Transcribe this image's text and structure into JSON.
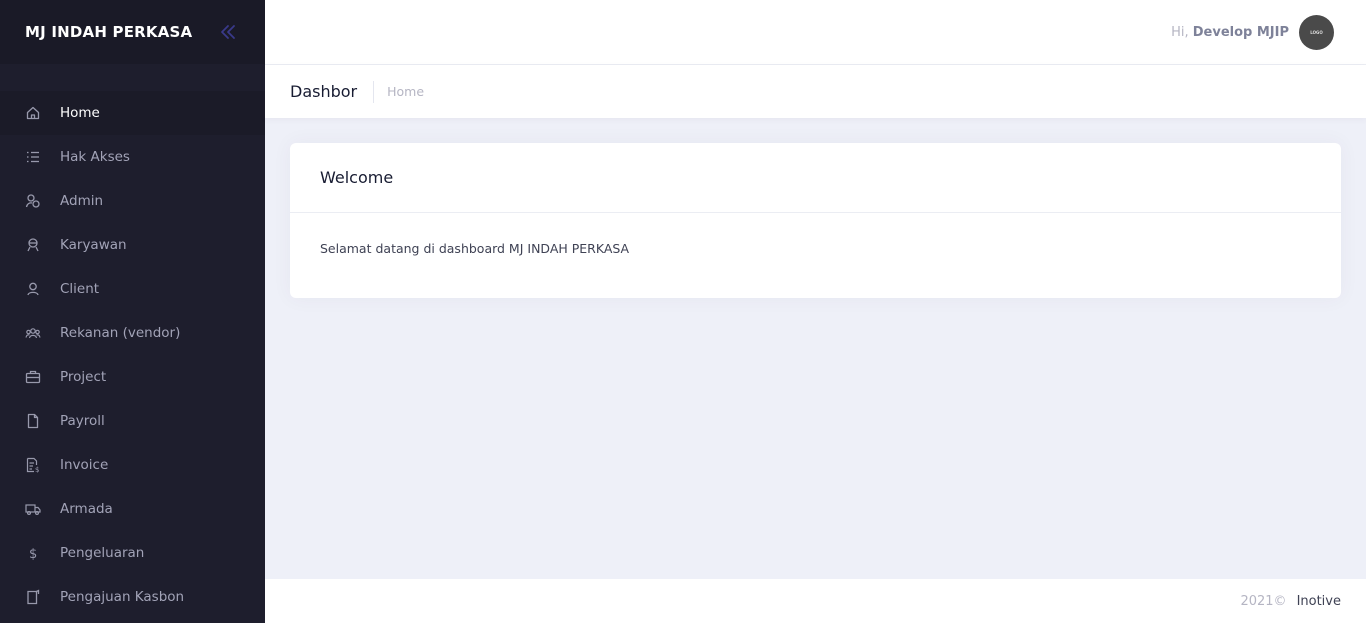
{
  "colors": {
    "sidebar_bg": "#1E1E2D",
    "brand_bg": "#1A1A27",
    "menu_text": "#A2A3B7",
    "menu_icon": "#9899AC",
    "active_text": "#FFFFFF",
    "collapse_icon": "#3A3A8A",
    "page_bg": "#EEF0F8"
  },
  "brand": {
    "title": "MJ INDAH PERKASA",
    "collapse_icon": "double-chevron-left-icon"
  },
  "sidebar": {
    "items": [
      {
        "label": "Home",
        "icon": "home-icon",
        "active": true
      },
      {
        "label": "Hak Akses",
        "icon": "list-icon",
        "active": false
      },
      {
        "label": "Admin",
        "icon": "users-icon",
        "active": false
      },
      {
        "label": "Karyawan",
        "icon": "employee-icon",
        "active": false
      },
      {
        "label": "Client",
        "icon": "user-icon",
        "active": false
      },
      {
        "label": "Rekanan (vendor)",
        "icon": "group-icon",
        "active": false
      },
      {
        "label": "Project",
        "icon": "briefcase-icon",
        "active": false
      },
      {
        "label": "Payroll",
        "icon": "file-icon",
        "active": false
      },
      {
        "label": "Invoice",
        "icon": "invoice-icon",
        "active": false
      },
      {
        "label": "Armada",
        "icon": "truck-icon",
        "active": false
      },
      {
        "label": "Pengeluaran",
        "icon": "dollar-icon",
        "active": false
      },
      {
        "label": "Pengajuan Kasbon",
        "icon": "note-icon",
        "active": false
      }
    ]
  },
  "header": {
    "greeting": "Hi,",
    "user_name": "Develop MJIP",
    "avatar_text": "LOGO"
  },
  "subheader": {
    "title": "Dashbor",
    "breadcrumb": "Home"
  },
  "card": {
    "title": "Welcome",
    "text": "Selamat datang di dashboard MJ INDAH PERKASA"
  },
  "footer": {
    "year": "2021©",
    "link": "Inotive"
  }
}
